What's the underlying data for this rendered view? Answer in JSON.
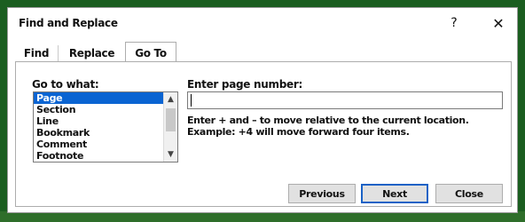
{
  "window": {
    "title": "Find and Replace",
    "help_glyph": "?",
    "close_glyph": "✕"
  },
  "tabs": [
    {
      "label": "Find",
      "active": false
    },
    {
      "label": "Replace",
      "active": false
    },
    {
      "label": "Go To",
      "active": true
    }
  ],
  "goto": {
    "label": "Go to what:",
    "items": [
      "Page",
      "Section",
      "Line",
      "Bookmark",
      "Comment",
      "Footnote"
    ],
    "selected_item": "Page",
    "scroll_up_glyph": "▲",
    "scroll_down_glyph": "▼"
  },
  "page_number": {
    "label": "Enter page number:",
    "value": ""
  },
  "help_text": "Enter + and – to move relative to the current location. Example: +4 will move forward four items.",
  "buttons": {
    "previous": "Previous",
    "next": "Next",
    "close": "Close"
  },
  "colors": {
    "selection": "#0a64d2",
    "default_button_border": "#1a62c6"
  },
  "icons": {
    "help": "help-icon",
    "close": "close-icon"
  }
}
